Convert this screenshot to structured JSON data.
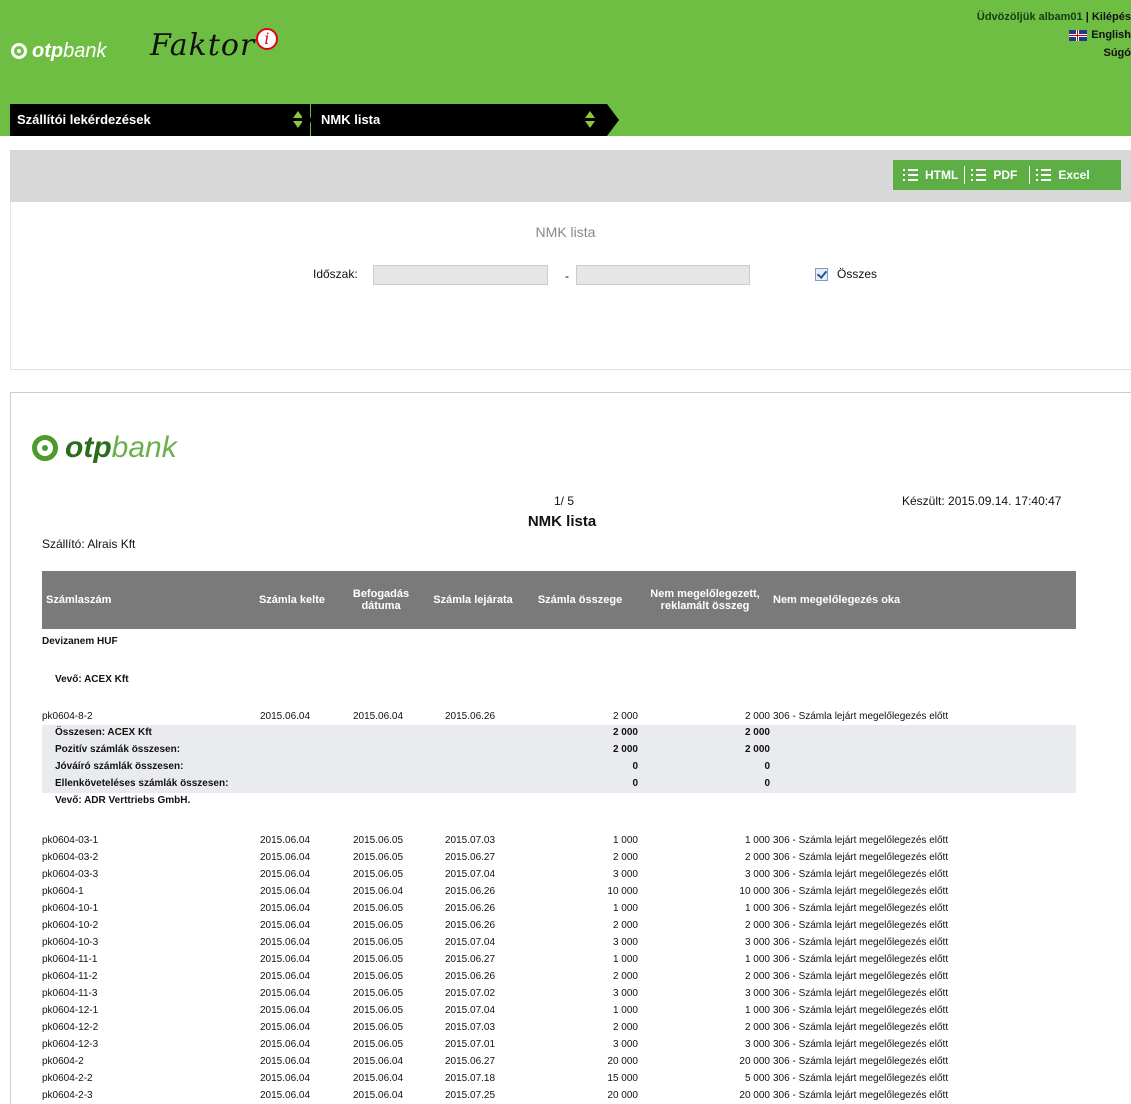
{
  "header": {
    "bank_logo_text_bold": "otp",
    "bank_logo_text": "bank",
    "app_name": "Faktor",
    "app_badge": "i",
    "welcome": "Üdvözöljük albam01",
    "logout": "Kilépés",
    "language": "English",
    "help": "Súgó"
  },
  "breadcrumb": {
    "item1": "Szállítói lekérdezések",
    "item2": "NMK lista"
  },
  "toolbar": {
    "html": "HTML",
    "pdf": "PDF",
    "excel": "Excel"
  },
  "filter": {
    "title": "NMK lista",
    "period_label": "Időszak:",
    "date_from": "",
    "date_to": "",
    "separator": "-",
    "all_label": "Összes",
    "all_checked": true
  },
  "report": {
    "logo_bold": "otp",
    "logo_text": "bank",
    "page": "1/ 5",
    "title": "NMK lista",
    "created": "Készült: 2015.09.14. 17:40:47",
    "supplier": "Szállító: Alrais Kft",
    "columns": {
      "invoice_no": "Számlaszám",
      "invoice_date": "Számla kelte",
      "acceptance_date_1": "Befogadás",
      "acceptance_date_2": "dátuma",
      "due_date": "Számla lejárata",
      "amount": "Számla összege",
      "not_financed_1": "Nem megelőlegezett,",
      "not_financed_2": "reklamált összeg",
      "reason": "Nem megelőlegezés oka"
    },
    "currency_group": "Devizanem HUF",
    "buyer1": {
      "label": "Vevő: ACEX Kft",
      "rows": [
        {
          "no": "pk0604-8-2",
          "kelte": "2015.06.04",
          "bef": "2015.06.04",
          "lej": "2015.06.26",
          "oss": "2 000",
          "nem": "2 000",
          "oka": "306 - Számla lejárt megelőlegezés előtt"
        }
      ],
      "summary": [
        {
          "label": "Összesen: ACEX Kft",
          "oss": "2 000",
          "nem": "2 000"
        },
        {
          "label": "Pozitív számlák összesen:",
          "oss": "2 000",
          "nem": "2 000"
        },
        {
          "label": "Jóváíró számlák összesen:",
          "oss": "0",
          "nem": "0"
        },
        {
          "label": "Ellenköveteléses számlák összesen:",
          "oss": "0",
          "nem": "0"
        }
      ]
    },
    "buyer2": {
      "label": "Vevő: ADR Verttriebs GmbH.",
      "rows": [
        {
          "no": "pk0604-03-1",
          "kelte": "2015.06.04",
          "bef": "2015.06.05",
          "lej": "2015.07.03",
          "oss": "1 000",
          "nem": "1 000",
          "oka": "306 - Számla lejárt megelőlegezés előtt"
        },
        {
          "no": "pk0604-03-2",
          "kelte": "2015.06.04",
          "bef": "2015.06.05",
          "lej": "2015.06.27",
          "oss": "2 000",
          "nem": "2 000",
          "oka": "306 - Számla lejárt megelőlegezés előtt"
        },
        {
          "no": "pk0604-03-3",
          "kelte": "2015.06.04",
          "bef": "2015.06.05",
          "lej": "2015.07.04",
          "oss": "3 000",
          "nem": "3 000",
          "oka": "306 - Számla lejárt megelőlegezés előtt"
        },
        {
          "no": "pk0604-1",
          "kelte": "2015.06.04",
          "bef": "2015.06.04",
          "lej": "2015.06.26",
          "oss": "10 000",
          "nem": "10 000",
          "oka": "306 - Számla lejárt megelőlegezés előtt"
        },
        {
          "no": "pk0604-10-1",
          "kelte": "2015.06.04",
          "bef": "2015.06.05",
          "lej": "2015.06.26",
          "oss": "1 000",
          "nem": "1 000",
          "oka": "306 - Számla lejárt megelőlegezés előtt"
        },
        {
          "no": "pk0604-10-2",
          "kelte": "2015.06.04",
          "bef": "2015.06.05",
          "lej": "2015.06.26",
          "oss": "2 000",
          "nem": "2 000",
          "oka": "306 - Számla lejárt megelőlegezés előtt"
        },
        {
          "no": "pk0604-10-3",
          "kelte": "2015.06.04",
          "bef": "2015.06.05",
          "lej": "2015.07.04",
          "oss": "3 000",
          "nem": "3 000",
          "oka": "306 - Számla lejárt megelőlegezés előtt"
        },
        {
          "no": "pk0604-11-1",
          "kelte": "2015.06.04",
          "bef": "2015.06.05",
          "lej": "2015.06.27",
          "oss": "1 000",
          "nem": "1 000",
          "oka": "306 - Számla lejárt megelőlegezés előtt"
        },
        {
          "no": "pk0604-11-2",
          "kelte": "2015.06.04",
          "bef": "2015.06.05",
          "lej": "2015.06.26",
          "oss": "2 000",
          "nem": "2 000",
          "oka": "306 - Számla lejárt megelőlegezés előtt"
        },
        {
          "no": "pk0604-11-3",
          "kelte": "2015.06.04",
          "bef": "2015.06.05",
          "lej": "2015.07.02",
          "oss": "3 000",
          "nem": "3 000",
          "oka": "306 - Számla lejárt megelőlegezés előtt"
        },
        {
          "no": "pk0604-12-1",
          "kelte": "2015.06.04",
          "bef": "2015.06.05",
          "lej": "2015.07.04",
          "oss": "1 000",
          "nem": "1 000",
          "oka": "306 - Számla lejárt megelőlegezés előtt"
        },
        {
          "no": "pk0604-12-2",
          "kelte": "2015.06.04",
          "bef": "2015.06.05",
          "lej": "2015.07.03",
          "oss": "2 000",
          "nem": "2 000",
          "oka": "306 - Számla lejárt megelőlegezés előtt"
        },
        {
          "no": "pk0604-12-3",
          "kelte": "2015.06.04",
          "bef": "2015.06.05",
          "lej": "2015.07.01",
          "oss": "3 000",
          "nem": "3 000",
          "oka": "306 - Számla lejárt megelőlegezés előtt"
        },
        {
          "no": "pk0604-2",
          "kelte": "2015.06.04",
          "bef": "2015.06.04",
          "lej": "2015.06.27",
          "oss": "20 000",
          "nem": "20 000",
          "oka": "306 - Számla lejárt megelőlegezés előtt"
        },
        {
          "no": "pk0604-2-2",
          "kelte": "2015.06.04",
          "bef": "2015.06.04",
          "lej": "2015.07.18",
          "oss": "15 000",
          "nem": "5 000",
          "oka": "306 - Számla lejárt megelőlegezés előtt"
        },
        {
          "no": "pk0604-2-3",
          "kelte": "2015.06.04",
          "bef": "2015.06.04",
          "lej": "2015.07.25",
          "oss": "20 000",
          "nem": "20 000",
          "oka": "306 - Számla lejárt megelőlegezés előtt"
        }
      ]
    }
  }
}
